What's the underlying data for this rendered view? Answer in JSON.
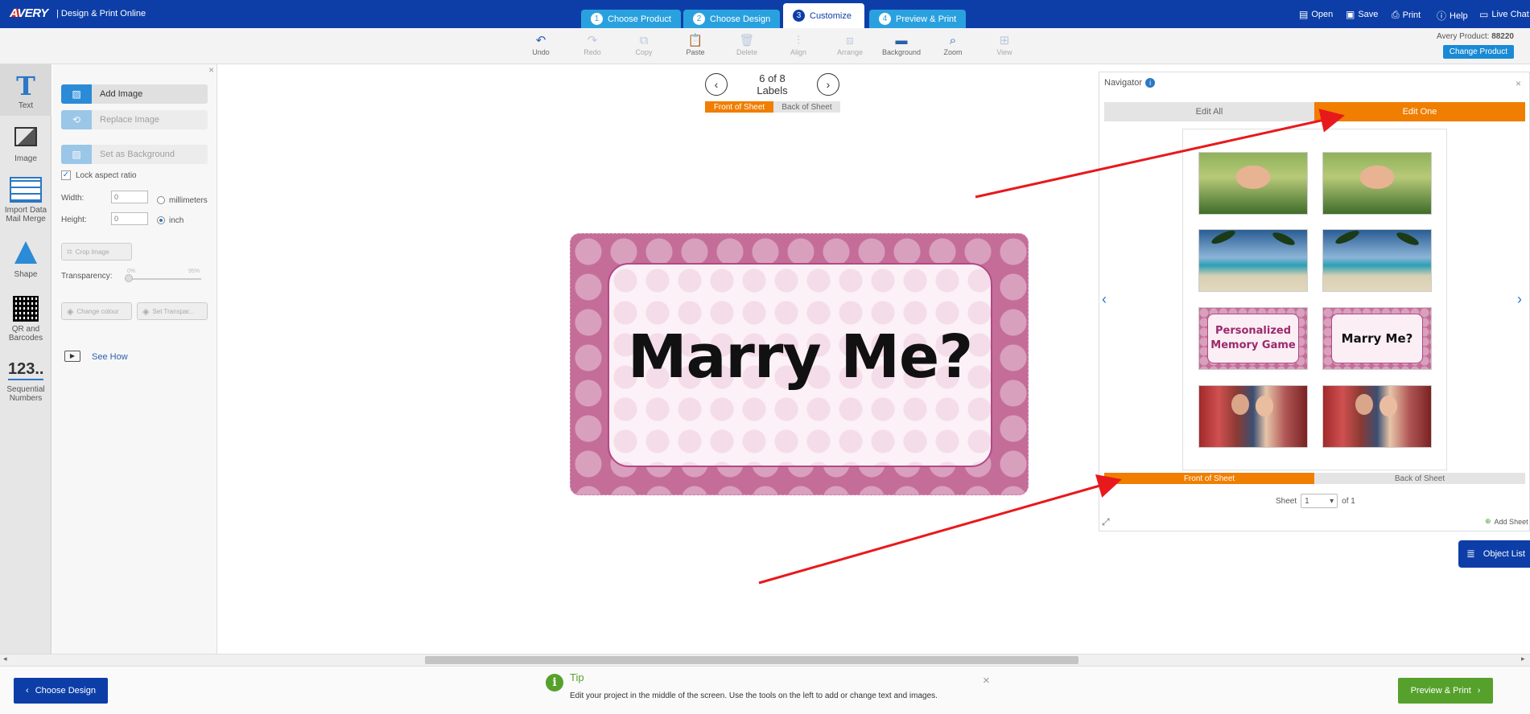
{
  "brand": {
    "logo": "AVERY",
    "subtitle": "|  Design & Print Online"
  },
  "steps": [
    {
      "num": "1",
      "label": "Choose Product"
    },
    {
      "num": "2",
      "label": "Choose Design"
    },
    {
      "num": "3",
      "label": "Customize"
    },
    {
      "num": "4",
      "label": "Preview & Print"
    }
  ],
  "top_links": {
    "open": "Open",
    "save": "Save",
    "print": "Print",
    "help": "Help",
    "chat": "Live Chat"
  },
  "toolbar": {
    "undo": "Undo",
    "redo": "Redo",
    "copy": "Copy",
    "paste": "Paste",
    "delete": "Delete",
    "align": "Align",
    "arrange": "Arrange",
    "background": "Background",
    "zoom": "Zoom",
    "view": "View"
  },
  "product": {
    "label": "Avery Product:",
    "number": "88220",
    "change": "Change Product"
  },
  "rail": {
    "text": "Text",
    "image": "Image",
    "import": "Import Data Mail Merge",
    "shape": "Shape",
    "qr": "QR and Barcodes",
    "seq_glyph": "123..",
    "seq": "Sequential Numbers"
  },
  "panel": {
    "add_image": "Add Image",
    "replace_image": "Replace Image",
    "set_background": "Set as Background",
    "lock_aspect": "Lock aspect ratio",
    "width_label": "Width:",
    "width_value": "0",
    "height_label": "Height:",
    "height_value": "0",
    "unit_mm": "millimeters",
    "unit_inch": "inch",
    "crop": "Crop Image",
    "transparency": "Transparency:",
    "trans_min": "0%",
    "trans_max": "95%",
    "change_colour": "Change colour",
    "set_transparent": "Set Transpar...",
    "see_how": "See How"
  },
  "canvas": {
    "page_indicator": "6 of 8",
    "page_unit": "Labels",
    "front_tab": "Front of Sheet",
    "back_tab": "Back of Sheet",
    "label_text": "Marry Me?"
  },
  "navigator": {
    "title": "Navigator",
    "edit_all": "Edit All",
    "edit_one": "Edit One",
    "thumb_text_1": "Personalized Memory Game",
    "thumb_text_2": "Marry Me?",
    "front_tab": "Front of Sheet",
    "back_tab": "Back of Sheet",
    "sheet_label": "Sheet",
    "sheet_value": "1",
    "sheet_of": "of 1",
    "add_sheet": "Add Sheet"
  },
  "object_list": "Object List",
  "footer": {
    "back": "Choose Design",
    "tip_title": "Tip",
    "tip_text": "Edit your project in the middle of the screen. Use the tools on the left to add or change text and images.",
    "next": "Preview & Print"
  },
  "colors": {
    "primary": "#0d3ea8",
    "tab": "#2aa1df",
    "accent_orange": "#f07e00",
    "green": "#56a12b",
    "arrow": "#e8191c"
  }
}
